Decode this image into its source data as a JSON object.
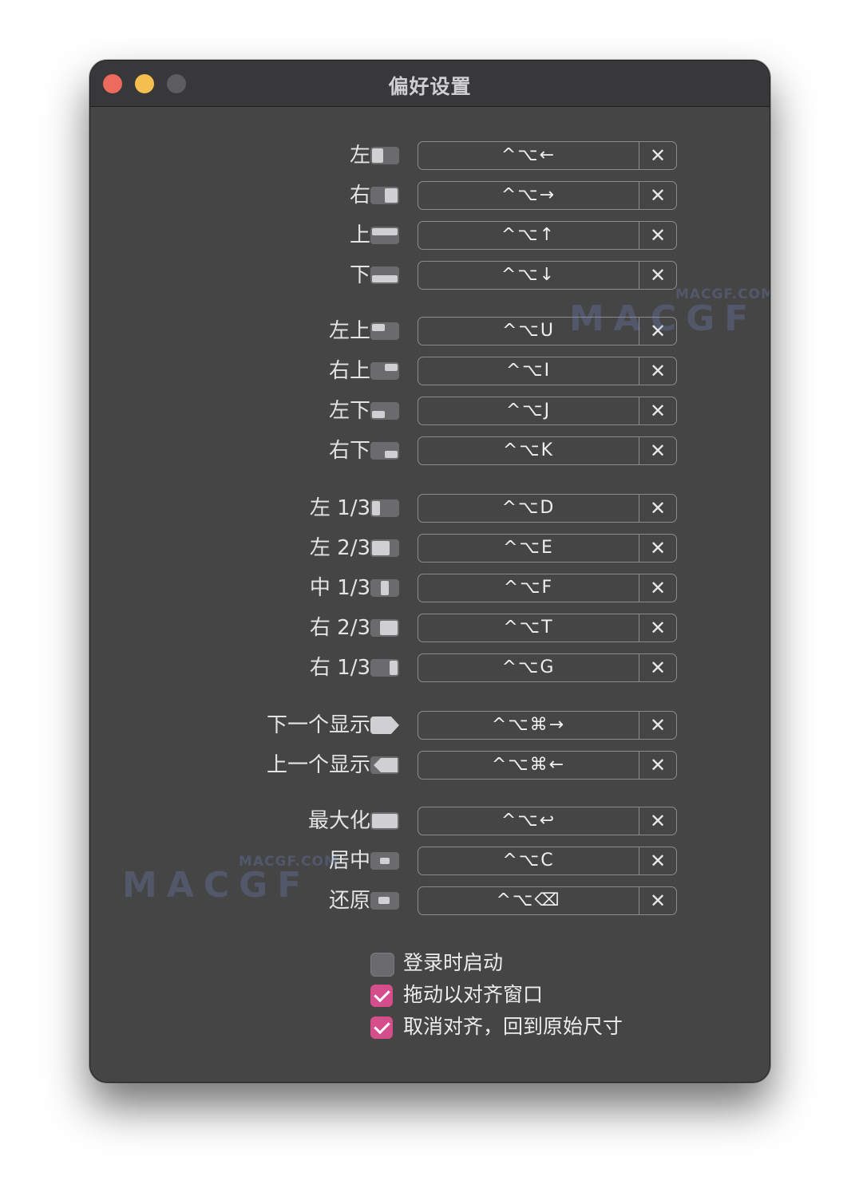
{
  "window": {
    "title": "偏好设置"
  },
  "rows": [
    {
      "label": "左",
      "shortcut": "^⌥←",
      "icon": "left-half-icon"
    },
    {
      "label": "右",
      "shortcut": "^⌥→",
      "icon": "right-half-icon"
    },
    {
      "label": "上",
      "shortcut": "^⌥↑",
      "icon": "top-half-icon"
    },
    {
      "label": "下",
      "shortcut": "^⌥↓",
      "icon": "bottom-half-icon"
    },
    {
      "label": "左上",
      "shortcut": "^⌥U",
      "icon": "top-left-icon"
    },
    {
      "label": "右上",
      "shortcut": "^⌥I",
      "icon": "top-right-icon"
    },
    {
      "label": "左下",
      "shortcut": "^⌥J",
      "icon": "bottom-left-icon"
    },
    {
      "label": "右下",
      "shortcut": "^⌥K",
      "icon": "bottom-right-icon"
    },
    {
      "label": "左 1/3",
      "shortcut": "^⌥D",
      "icon": "left-third-icon"
    },
    {
      "label": "左 2/3",
      "shortcut": "^⌥E",
      "icon": "left-two-thirds-icon"
    },
    {
      "label": "中 1/3",
      "shortcut": "^⌥F",
      "icon": "center-third-icon"
    },
    {
      "label": "右 2/3",
      "shortcut": "^⌥T",
      "icon": "right-two-thirds-icon"
    },
    {
      "label": "右 1/3",
      "shortcut": "^⌥G",
      "icon": "right-third-icon"
    },
    {
      "label": "下一个显示",
      "shortcut": "^⌥⌘→",
      "icon": "next-display-icon"
    },
    {
      "label": "上一个显示",
      "shortcut": "^⌥⌘←",
      "icon": "previous-display-icon"
    },
    {
      "label": "最大化",
      "shortcut": "^⌥↩",
      "icon": "maximize-icon"
    },
    {
      "label": "居中",
      "shortcut": "^⌥C",
      "icon": "center-icon"
    },
    {
      "label": "还原",
      "shortcut": "^⌥⌫",
      "icon": "restore-icon"
    }
  ],
  "clear_glyph": "✕",
  "checkboxes": [
    {
      "label": "登录时启动",
      "checked": false
    },
    {
      "label": "拖动以对齐窗口",
      "checked": true
    },
    {
      "label": "取消对齐，回到原始尺寸",
      "checked": true
    }
  ],
  "watermark": {
    "text1": "MACGF.COM",
    "text2": "MACGF"
  }
}
